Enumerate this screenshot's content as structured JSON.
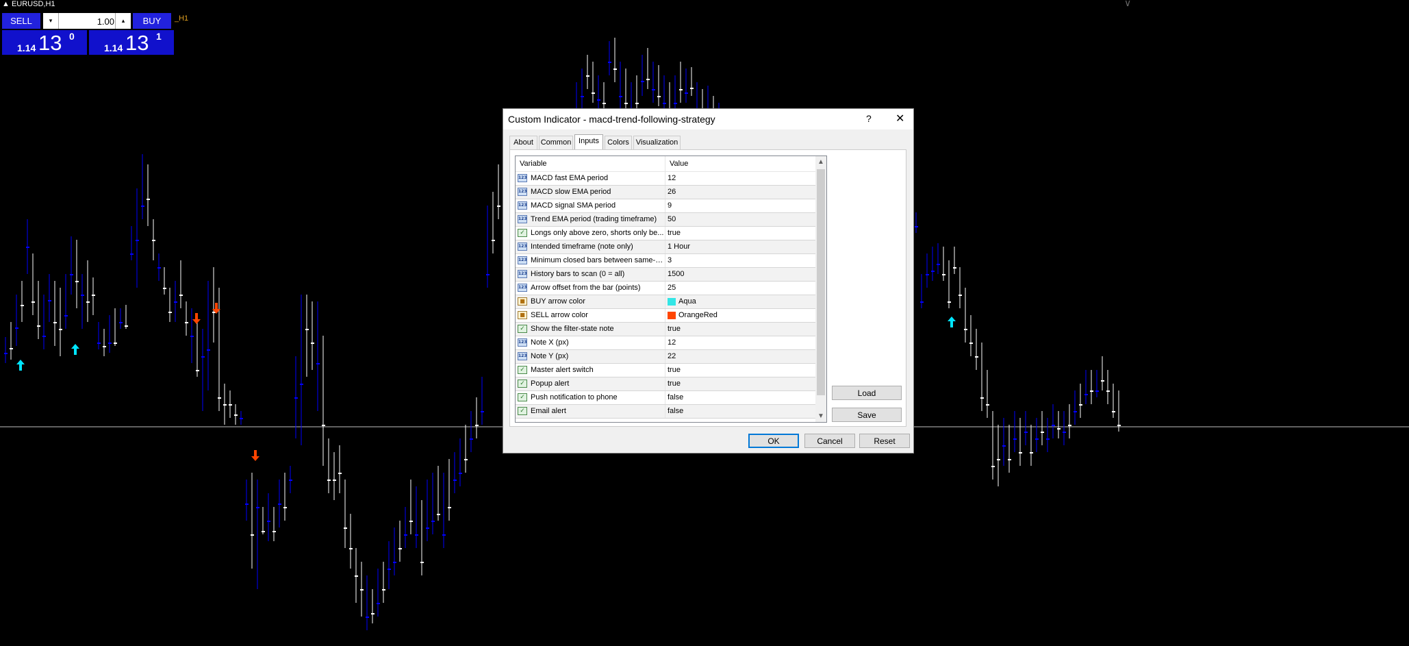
{
  "chart": {
    "symbol_title": "EURUSD,H1",
    "timeframe_label": "_H1",
    "top_right_mark": "∨"
  },
  "trading_panel": {
    "sell_label": "SELL",
    "buy_label": "BUY",
    "lot_value": "1.00",
    "lot_down": "▾",
    "lot_up": "▴",
    "bid": {
      "big_figure": "1.14",
      "pips": "13",
      "point": "0"
    },
    "ask": {
      "big_figure": "1.14",
      "pips": "13",
      "point": "1"
    }
  },
  "dialog": {
    "title": "Custom Indicator - macd-trend-following-strategy",
    "help": "?",
    "close": "✕",
    "tabs": [
      {
        "label": "About"
      },
      {
        "label": "Common"
      },
      {
        "label": "Inputs"
      },
      {
        "label": "Colors"
      },
      {
        "label": "Visualization"
      }
    ],
    "active_tab": "Inputs",
    "grid": {
      "header_variable": "Variable",
      "header_value": "Value",
      "rows": [
        {
          "name": "MACD fast EMA period",
          "value": "12",
          "type": "int"
        },
        {
          "name": "MACD slow EMA period",
          "value": "26",
          "type": "int"
        },
        {
          "name": "MACD signal SMA period",
          "value": "9",
          "type": "int"
        },
        {
          "name": "Trend EMA period (trading timeframe)",
          "value": "50",
          "type": "int"
        },
        {
          "name": "Longs only above zero, shorts only be...",
          "value": "true",
          "type": "bool"
        },
        {
          "name": "Intended timeframe (note only)",
          "value": "1 Hour",
          "type": "int"
        },
        {
          "name": "Minimum closed bars between same-si...",
          "value": "3",
          "type": "int"
        },
        {
          "name": "History bars to scan (0 = all)",
          "value": "1500",
          "type": "int"
        },
        {
          "name": "Arrow offset from the bar (points)",
          "value": "25",
          "type": "int"
        },
        {
          "name": "BUY arrow color",
          "value": "Aqua",
          "type": "color",
          "color": "#33e6e6"
        },
        {
          "name": "SELL arrow color",
          "value": "OrangeRed",
          "type": "color",
          "color": "#ff4500"
        },
        {
          "name": "Show the filter-state note",
          "value": "true",
          "type": "bool"
        },
        {
          "name": "Note X (px)",
          "value": "12",
          "type": "int"
        },
        {
          "name": "Note Y (px)",
          "value": "22",
          "type": "int"
        },
        {
          "name": "Master alert switch",
          "value": "true",
          "type": "bool"
        },
        {
          "name": "Popup alert",
          "value": "true",
          "type": "bool"
        },
        {
          "name": "Push notification to phone",
          "value": "false",
          "type": "bool"
        },
        {
          "name": "Email alert",
          "value": "false",
          "type": "bool"
        }
      ]
    },
    "buttons": {
      "load": "Load",
      "save": "Save",
      "ok": "OK",
      "cancel": "Cancel",
      "reset": "Reset"
    },
    "icon_glyphs": {
      "int": "123",
      "bool": "✓",
      "color": "■"
    }
  },
  "colors": {
    "background": "#000000",
    "bull_candle": "#ffffff",
    "bear_candle": "#0000ff",
    "buy_arrow": "#00e5ff",
    "sell_arrow": "#ff4500",
    "price_line": "#c0c0c0"
  }
}
